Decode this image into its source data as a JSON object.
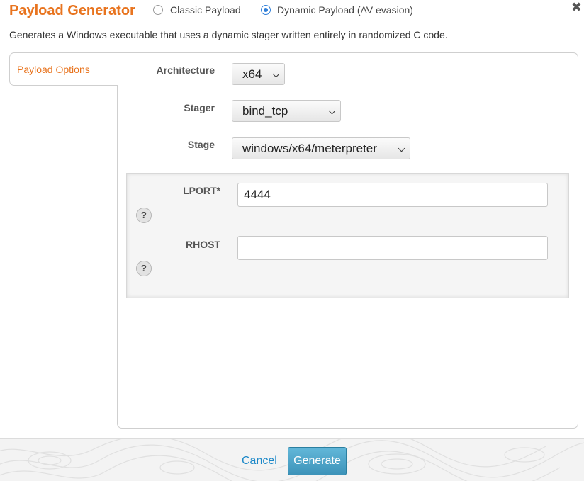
{
  "dialog": {
    "title": "Payload Generator",
    "close_icon": "close-icon",
    "description": "Generates a Windows executable that uses a dynamic stager written entirely in randomized C code."
  },
  "payload_type": {
    "options": [
      {
        "label": "Classic Payload",
        "checked": false
      },
      {
        "label": "Dynamic Payload (AV evasion)",
        "checked": true
      }
    ]
  },
  "tabs": [
    {
      "label": "Payload Options",
      "active": true
    }
  ],
  "form": {
    "architecture": {
      "label": "Architecture",
      "value": "x64"
    },
    "stager": {
      "label": "Stager",
      "value": "bind_tcp"
    },
    "stage": {
      "label": "Stage",
      "value": "windows/x64/meterpreter"
    }
  },
  "options": {
    "lport": {
      "label": "LPORT*",
      "value": "4444",
      "help": "?"
    },
    "rhost": {
      "label": "RHOST",
      "value": "",
      "help": "?"
    }
  },
  "footer": {
    "cancel_label": "Cancel",
    "generate_label": "Generate"
  },
  "colors": {
    "accent": "#e8741f",
    "link": "#1c88c8",
    "button": "#4fa5c9",
    "radio": "#2f7ed8"
  }
}
